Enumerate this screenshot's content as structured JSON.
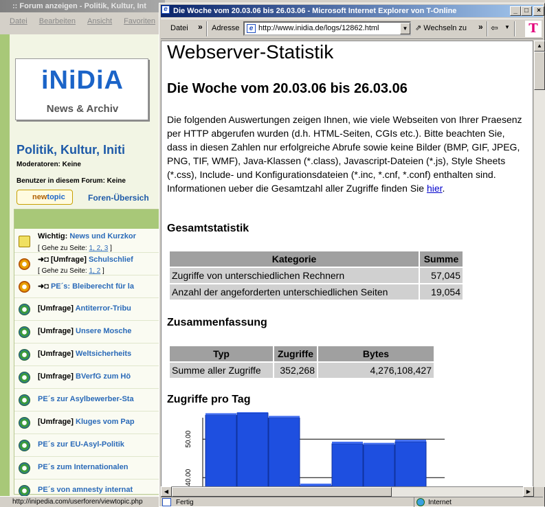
{
  "background_window": {
    "title": ":: Forum anzeigen - Politik, Kultur, Int",
    "menu": [
      "Datei",
      "Bearbeiten",
      "Ansicht",
      "Favoriten"
    ],
    "logo_main": "iNiDiA",
    "logo_sub": "News & Archiv",
    "forum_title": "Politik, Kultur, Initi",
    "moderators": "Moderatoren: Keine",
    "users_in_forum": "Benutzer in diesem Forum: Keine",
    "newtopic_label_a": "new",
    "newtopic_label_b": "topic",
    "overview_link": "Foren-Übersich",
    "topics": [
      {
        "prefix": "Wichtig:",
        "title": "News und Kurzkor",
        "sub": "[ ",
        "sub_label": "Gehe zu Seite: ",
        "pages": "1, 2, 3",
        "sub_end": " ]",
        "icon": "imp"
      },
      {
        "prefix": "➜◘ [Umfrage]",
        "title": "Schulschlief",
        "sub": "[ ",
        "sub_label": "Gehe zu Seite: ",
        "pages": "1, 2",
        "sub_end": " ]",
        "icon": "hot"
      },
      {
        "prefix": "➜◘",
        "title": "PE´s: Bleiberecht für la",
        "icon": "hot"
      },
      {
        "prefix": "[Umfrage]",
        "title": "Antiterror-Tribu",
        "icon": "norm"
      },
      {
        "prefix": "[Umfrage]",
        "title": "Unsere Mosche",
        "icon": "norm"
      },
      {
        "prefix": "[Umfrage]",
        "title": "Weltsicherheits",
        "icon": "norm"
      },
      {
        "prefix": "[Umfrage]",
        "title": "BVerfG zum Hö",
        "icon": "norm"
      },
      {
        "prefix": "",
        "title": "PE´s zur Asylbewerber-Sta",
        "icon": "norm"
      },
      {
        "prefix": "[Umfrage]",
        "title": "Kluges vom Pap",
        "icon": "norm"
      },
      {
        "prefix": "",
        "title": "PE´s zur EU-Asyl-Politik",
        "icon": "norm"
      },
      {
        "prefix": "",
        "title": "PE´s zum Internationalen",
        "icon": "norm"
      },
      {
        "prefix": "",
        "title": "PE´s von amnesty internat",
        "icon": "norm"
      }
    ],
    "status_url": "http://inipedia.com/userforen/viewtopic.php"
  },
  "ie_window": {
    "title": "Die Woche vom 20.03.06 bis 26.03.06 - Microsoft Internet Explorer von T-Online",
    "menu_datei": "Datei",
    "address_label": "Adresse",
    "address_value": "http://www.inidia.de/logs/12862.html",
    "go_label": "Wechseln zu",
    "brand_letter": "T",
    "status_text": "Fertig",
    "status_zone": "Internet"
  },
  "page": {
    "h1": "Webserver-Statistik",
    "h2": "Die Woche vom 20.03.06 bis 26.03.06",
    "intro": "Die folgenden Auswertungen zeigen Ihnen, wie viele Webseiten von Ihrer Praesenz per HTTP abgerufen wurden (d.h. HTML-Seiten, CGIs etc.). Bitte beachten Sie, dass in diesen Zahlen nur erfolgreiche Abrufe sowie keine Bilder (BMP, GIF, JPEG, PNG, TIF, WMF), Java-Klassen (*.class), Javascript-Dateien (*.js), Style Sheets (*.css), Include- und Konfigurationsdateien (*.inc, *.cnf, *.conf) enthalten sind. Informationen ueber die Gesamtzahl aller Zugriffe finden Sie ",
    "intro_link": "hier",
    "intro_end": ".",
    "gesamt_title": "Gesamtstatistik",
    "gesamt_headers": [
      "Kategorie",
      "Summe"
    ],
    "gesamt_rows": [
      [
        "Zugriffe von unterschiedlichen Rechnern",
        "57,045"
      ],
      [
        "Anzahl der angeforderten unterschiedlichen Seiten",
        "19,054"
      ]
    ],
    "zusammen_title": "Zusammenfassung",
    "zusammen_headers": [
      "Typ",
      "Zugriffe",
      "Bytes"
    ],
    "zusammen_rows": [
      [
        "Summe aller Zugriffe",
        "352,268",
        "4,276,108,427"
      ]
    ],
    "daily_title": "Zugriffe pro Tag"
  },
  "chart_data": {
    "type": "bar",
    "title": "Zugriffe pro Tag",
    "tick_labels": [
      "50.00",
      "40.00"
    ],
    "yticks": [
      50,
      40
    ],
    "ylim_visible": [
      37,
      57
    ],
    "values": [
      56.2,
      56.8,
      55.5,
      37.9,
      48.8,
      48.5,
      49.3
    ],
    "color": "#1e4fe0"
  }
}
